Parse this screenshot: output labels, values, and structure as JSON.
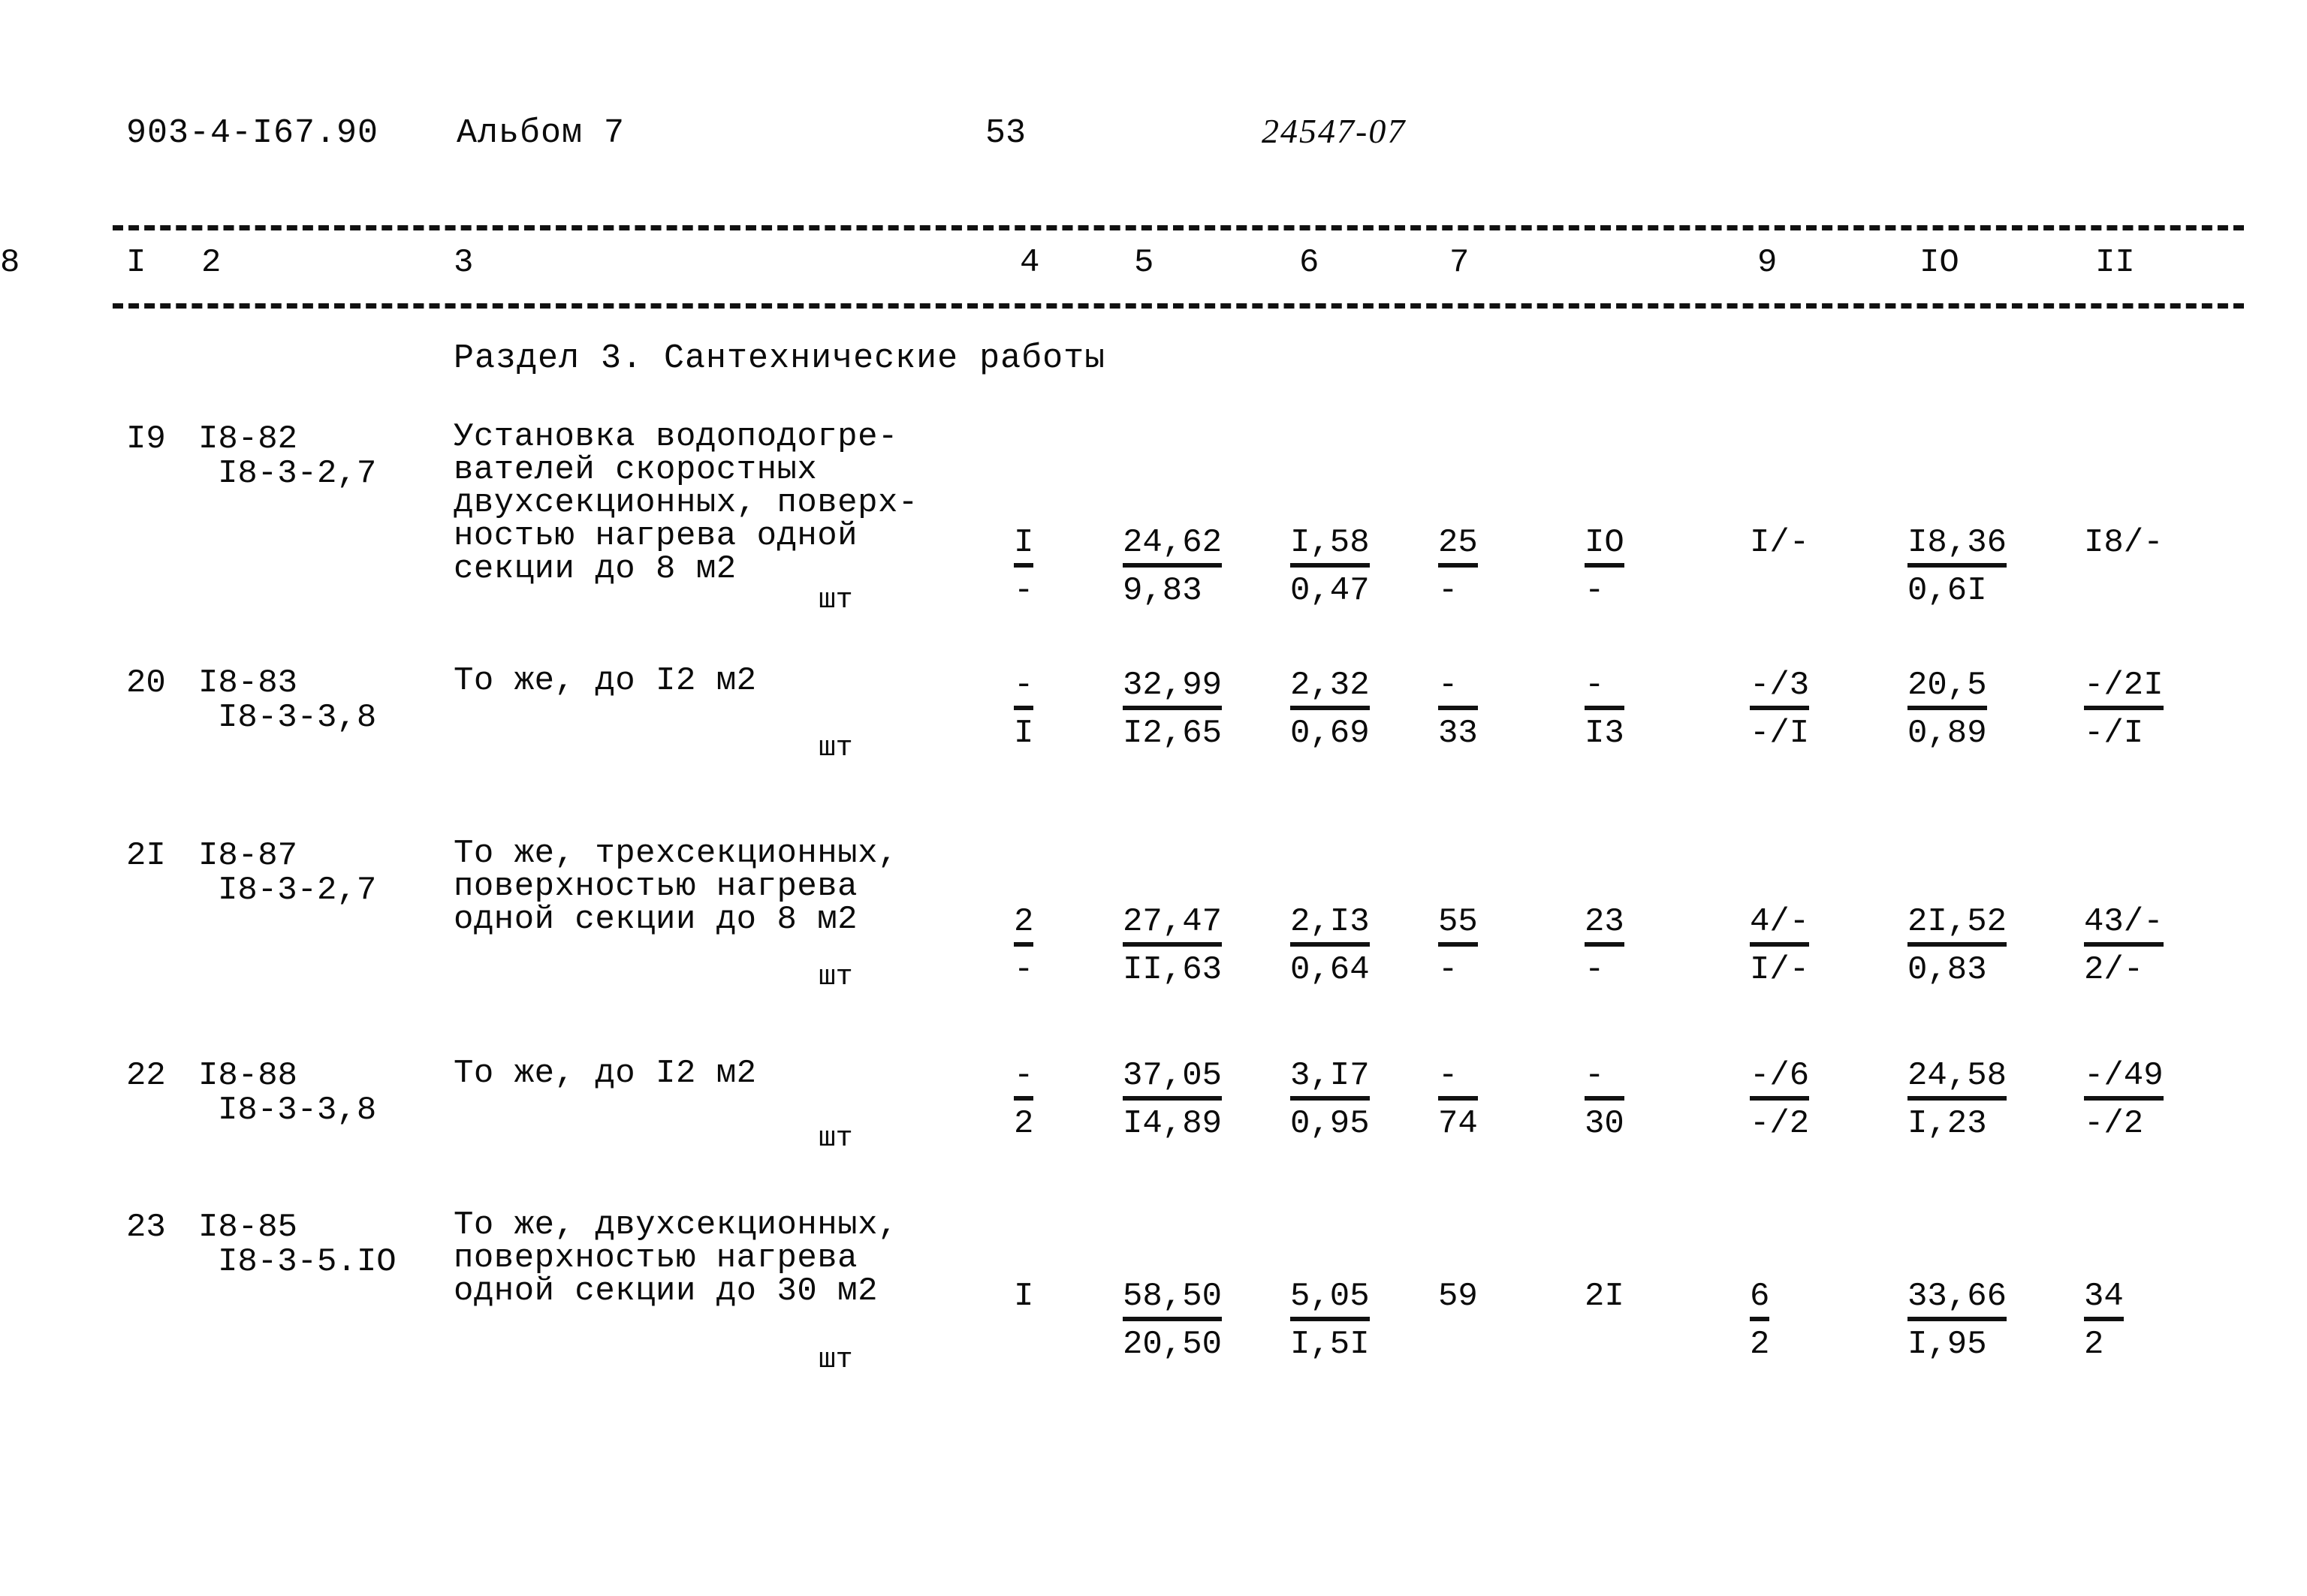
{
  "header": {
    "project_code": "903-4-I67.90",
    "album": "Альбом 7",
    "page_number": "53",
    "doc_number": "24547-07"
  },
  "table": {
    "column_numbers": [
      "I",
      "2",
      "3",
      "4",
      "5",
      "6",
      "7",
      "8",
      "9",
      "IO",
      "II"
    ],
    "section_heading": "Раздел 3. Сантехнические работы",
    "rows": [
      {
        "no": "I9",
        "code_top": "I8-82",
        "code_bottom": "I8-3-2,7",
        "description": [
          "Установка водоподогре-",
          "вателей скоростных",
          "двухсекционных, поверх-",
          "ностью нагрева одной",
          "секции до 8 м2"
        ],
        "unit": "шт",
        "c4": {
          "num": "I",
          "den": "-",
          "ruled": true
        },
        "c5": {
          "num": "24,62",
          "den": "9,83",
          "ruled": true
        },
        "c6": {
          "num": "I,58",
          "den": "0,47",
          "ruled": true
        },
        "c7": {
          "num": "25",
          "den": "-",
          "ruled": true
        },
        "c8": {
          "num": "IO",
          "den": "-",
          "ruled": true
        },
        "c9": {
          "num": "I/-",
          "den": "",
          "ruled": false
        },
        "c10": {
          "num": "I8,36",
          "den": "0,6I",
          "ruled": true
        },
        "c11": {
          "num": "I8/-",
          "den": "",
          "ruled": false
        }
      },
      {
        "no": "20",
        "code_top": "I8-83",
        "code_bottom": "I8-3-3,8",
        "description": [
          "То же, до I2 м2"
        ],
        "unit": "шт",
        "c4": {
          "num": "-",
          "den": "I",
          "ruled": true
        },
        "c5": {
          "num": "32,99",
          "den": "I2,65",
          "ruled": true
        },
        "c6": {
          "num": "2,32",
          "den": "0,69",
          "ruled": true
        },
        "c7": {
          "num": "-",
          "den": "33",
          "ruled": true
        },
        "c8": {
          "num": "-",
          "den": "I3",
          "ruled": true
        },
        "c9": {
          "num": "-/3",
          "den": "-/I",
          "ruled": true
        },
        "c10": {
          "num": "20,5",
          "den": "0,89",
          "ruled": true
        },
        "c11": {
          "num": "-/2I",
          "den": "-/I",
          "ruled": true
        }
      },
      {
        "no": "2I",
        "code_top": "I8-87",
        "code_bottom": "I8-3-2,7",
        "description": [
          "То же, трехсекционных,",
          "поверхностью нагрева",
          "одной секции до 8 м2"
        ],
        "unit": "шт",
        "c4": {
          "num": "2",
          "den": "-",
          "ruled": true
        },
        "c5": {
          "num": "27,47",
          "den": "II,63",
          "ruled": true
        },
        "c6": {
          "num": "2,I3",
          "den": "0,64",
          "ruled": true
        },
        "c7": {
          "num": "55",
          "den": "-",
          "ruled": true
        },
        "c8": {
          "num": "23",
          "den": "-",
          "ruled": true
        },
        "c9": {
          "num": "4/-",
          "den": "I/-",
          "ruled": true
        },
        "c10": {
          "num": "2I,52",
          "den": "0,83",
          "ruled": true
        },
        "c11": {
          "num": "43/-",
          "den": "2/-",
          "ruled": true
        }
      },
      {
        "no": "22",
        "code_top": "I8-88",
        "code_bottom": "I8-3-3,8",
        "description": [
          "То же, до I2 м2"
        ],
        "unit": "шт",
        "c4": {
          "num": "-",
          "den": "2",
          "ruled": true
        },
        "c5": {
          "num": "37,05",
          "den": "I4,89",
          "ruled": true
        },
        "c6": {
          "num": "3,I7",
          "den": "0,95",
          "ruled": true
        },
        "c7": {
          "num": "-",
          "den": "74",
          "ruled": true
        },
        "c8": {
          "num": "-",
          "den": "30",
          "ruled": true
        },
        "c9": {
          "num": "-/6",
          "den": "-/2",
          "ruled": true
        },
        "c10": {
          "num": "24,58",
          "den": "I,23",
          "ruled": true
        },
        "c11": {
          "num": "-/49",
          "den": "-/2",
          "ruled": true
        }
      },
      {
        "no": "23",
        "code_top": "I8-85",
        "code_bottom": "I8-3-5.IO",
        "description": [
          "То же, двухсекционных,",
          "поверхностью нагрева",
          "одной секции до 30 м2"
        ],
        "unit": "шт",
        "c4": {
          "num": "I",
          "den": "",
          "ruled": false
        },
        "c5": {
          "num": "58,50",
          "den": "20,50",
          "ruled": true
        },
        "c6": {
          "num": "5,05",
          "den": "I,5I",
          "ruled": true
        },
        "c7": {
          "num": "59",
          "den": "",
          "ruled": false
        },
        "c8": {
          "num": "2I",
          "den": "",
          "ruled": false
        },
        "c9": {
          "num": "6",
          "den": "2",
          "ruled": true
        },
        "c10": {
          "num": "33,66",
          "den": "I,95",
          "ruled": true
        },
        "c11": {
          "num": "34",
          "den": "2",
          "ruled": true
        }
      }
    ]
  }
}
